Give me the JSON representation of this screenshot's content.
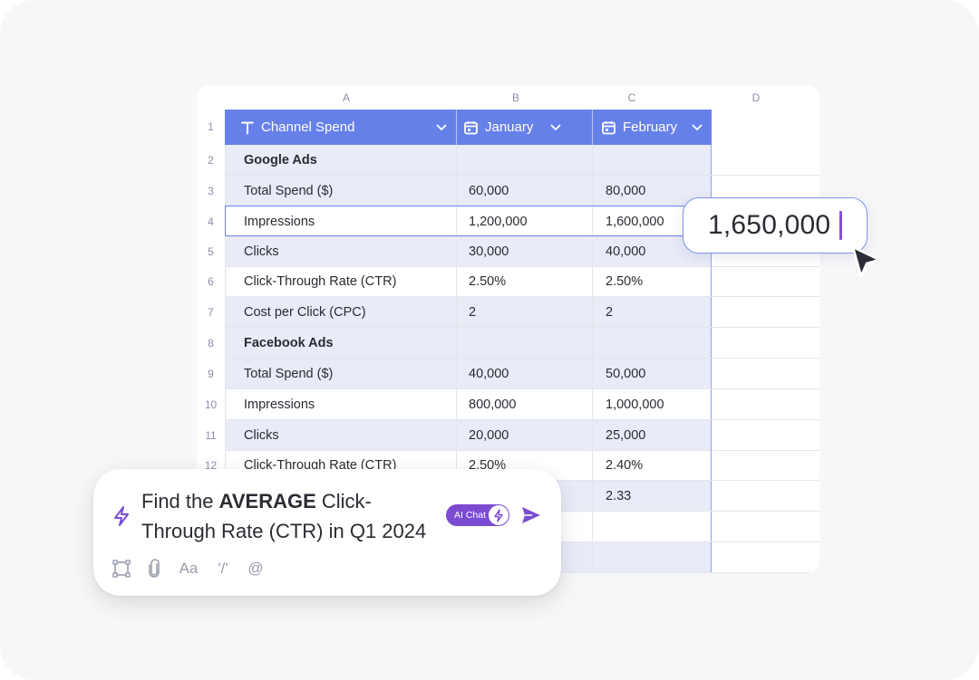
{
  "sheet": {
    "columns": [
      "A",
      "B",
      "C",
      "D"
    ],
    "headers": {
      "a": {
        "icon": "text-type-icon",
        "label": "Channel Spend"
      },
      "b": {
        "icon": "calendar-icon",
        "label": "January"
      },
      "c": {
        "icon": "calendar-icon",
        "label": "February"
      }
    },
    "row_numbers": [
      "1",
      "2",
      "3",
      "4",
      "5",
      "6",
      "7",
      "8",
      "9",
      "10",
      "11",
      "12"
    ],
    "rows": [
      {
        "a": "Google Ads",
        "b": "",
        "c": "",
        "section": true
      },
      {
        "a": "Total Spend ($)",
        "b": "60,000",
        "c": "80,000"
      },
      {
        "a": "Impressions",
        "b": "1,200,000",
        "c": "1,600,000",
        "selected": true
      },
      {
        "a": "Clicks",
        "b": "30,000",
        "c": "40,000"
      },
      {
        "a": "Click-Through Rate (CTR)",
        "b": "2.50%",
        "c": "2.50%"
      },
      {
        "a": "Cost per Click (CPC)",
        "b": "2",
        "c": "2"
      },
      {
        "a": "Facebook Ads",
        "b": "",
        "c": "",
        "section": true
      },
      {
        "a": "Total Spend ($)",
        "b": "40,000",
        "c": "50,000"
      },
      {
        "a": "Impressions",
        "b": "800,000",
        "c": "1,000,000"
      },
      {
        "a": "Clicks",
        "b": "20,000",
        "c": "25,000"
      },
      {
        "a": "Click-Through Rate (CTR)",
        "b": "2.50%",
        "c": "2.40%"
      },
      {
        "a": "",
        "b": "",
        "c": "2.33"
      },
      {
        "a": "",
        "b": "",
        "c": ""
      },
      {
        "a": "",
        "b": "",
        "c": ""
      }
    ]
  },
  "edit_popup": {
    "value": "1,650,000"
  },
  "chat": {
    "prompt_before": "Find the ",
    "prompt_bold": "AVERAGE",
    "prompt_after": " Click-Through Rate (CTR) in Q1 2024",
    "ai_chat_label": "AI Chat",
    "tool_icons": [
      "frame-select-icon",
      "attachment-icon",
      "text-format-icon",
      "slash-command-icon",
      "mention-icon"
    ],
    "tool_glyphs": {
      "text_format": "Aa",
      "slash": "'/'",
      "mention": "@"
    }
  },
  "colors": {
    "header_bg": "#6680ea",
    "row_shade": "#e9ebf7",
    "accent_purple": "#7b4bd0",
    "selection_border": "#6c82e0"
  }
}
